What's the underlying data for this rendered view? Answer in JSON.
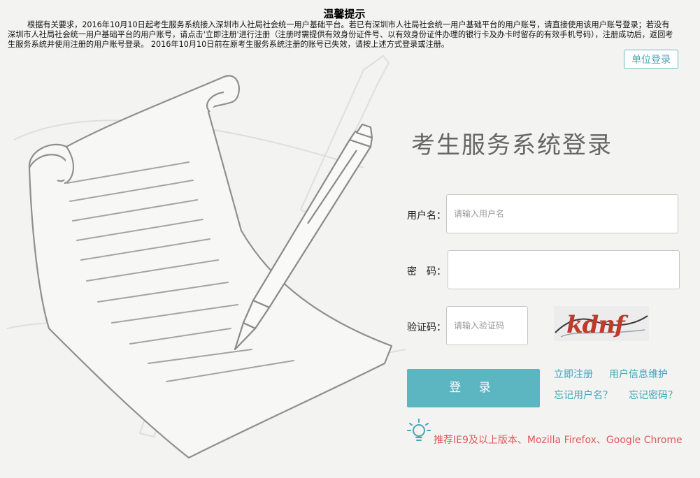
{
  "notice": {
    "title": "温馨提示",
    "body": "根据有关要求，2016年10月10日起考生服务系统接入深圳市人社局社会统一用户基础平台。若已有深圳市人社局社会统一用户基础平台的用户账号，请直接使用该用户账号登录；若没有深圳市人社局社会统一用户基础平台的用户账号，请点击'立即注册'进行注册（注册时需提供有效身份证件号、以有效身份证件办理的银行卡及办卡时留存的有效手机号码），注册成功后，返回考生服务系统并使用注册的用户账号登录。 2016年10月10日前在原考生服务系统注册的账号已失效，请按上述方式登录或注册。"
  },
  "unit_login_label": "单位登录",
  "login": {
    "title": "考生服务系统登录",
    "username_label": "用户名：",
    "username_placeholder": "请输入用户名",
    "username_value": "",
    "password_label": "密　码：",
    "password_value": "",
    "captcha_label": "验证码：",
    "captcha_placeholder": "请输入验证码",
    "captcha_value": "",
    "captcha_text": "kdnf",
    "submit_label": "登 录"
  },
  "links": {
    "register": "立即注册",
    "user_info": "用户信息维护",
    "forgot_username": "忘记用户名？",
    "forgot_password": "忘记密码？"
  },
  "browser_tip": "推荐IE9及以上版本、Mozilla Firefox、Google Chrome",
  "colors": {
    "accent": "#5bb6c2",
    "link": "#3aa6b6",
    "tip": "#e05a58",
    "background": "#f3f3f2"
  },
  "icons": {
    "illustration": "paper-and-pen-illustration",
    "tip": "lightbulb-icon"
  }
}
